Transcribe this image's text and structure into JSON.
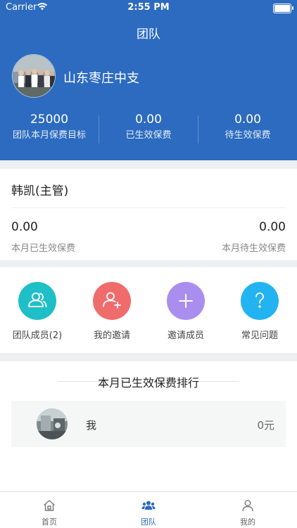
{
  "status_bar": {
    "carrier": "Carrier",
    "time": "2:55 PM"
  },
  "header": {
    "title": "团队",
    "team_name": "山东枣庄中支",
    "stats": [
      {
        "value": "25000",
        "label": "团队本月保费目标"
      },
      {
        "value": "0.00",
        "label": "已生效保费"
      },
      {
        "value": "0.00",
        "label": "待生效保费"
      }
    ]
  },
  "leader": {
    "name": "韩凯(主管)",
    "left_value": "0.00",
    "left_label": "本月已生效保费",
    "right_value": "0.00",
    "right_label": "本月待生效保费"
  },
  "actions": [
    {
      "label": "团队成员(2)",
      "icon": "team-members-icon",
      "color": "#1fbfc7"
    },
    {
      "label": "我的邀请",
      "icon": "invite-person-icon",
      "color": "#f06c6c"
    },
    {
      "label": "邀请成员",
      "icon": "plus-icon",
      "color": "#a98ef0"
    },
    {
      "label": "常见问题",
      "icon": "question-icon",
      "color": "#23b3f0"
    }
  ],
  "ranking": {
    "title": "本月已生效保费排行",
    "rows": [
      {
        "name": "我",
        "amount": "0元"
      }
    ]
  },
  "tabbar": {
    "tabs": [
      {
        "label": "首页",
        "icon": "home-icon"
      },
      {
        "label": "团队",
        "icon": "team-icon",
        "active": true
      },
      {
        "label": "我的",
        "icon": "profile-icon"
      }
    ]
  },
  "colors": {
    "brand": "#2c6bbf",
    "background": "#eeeff1"
  }
}
